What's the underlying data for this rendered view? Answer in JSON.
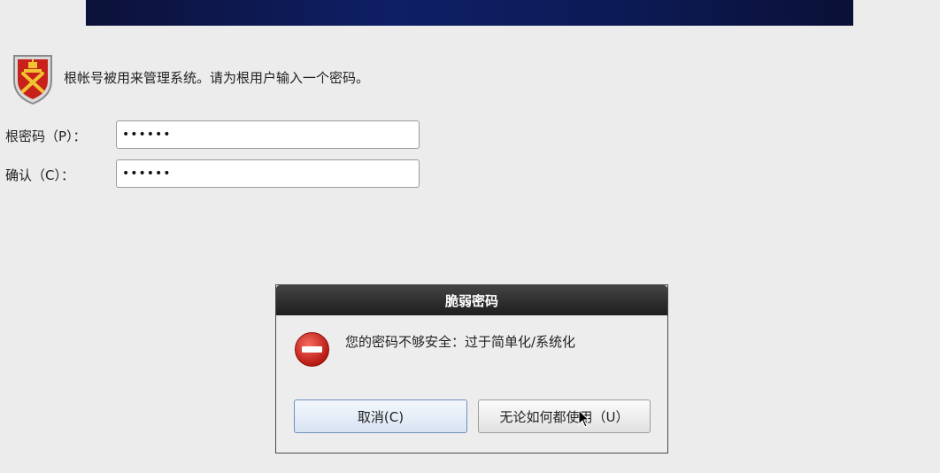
{
  "header": {
    "intro": "根帐号被用来管理系统。请为根用户输入一个密码。"
  },
  "form": {
    "password_label": "根密码（P）：",
    "password_value": "••••••",
    "confirm_label": "确认（C）：",
    "confirm_value": "••••••"
  },
  "dialog": {
    "title": "脆弱密码",
    "message": "您的密码不够安全：过于简单化/系统化",
    "cancel_label": "取消(C)",
    "use_anyway_label": "无论如何都使用（U）"
  },
  "colors": {
    "banner": "#0f1f66",
    "dialog_title_bg": "#2a2a2a",
    "error_icon": "#d8281e",
    "shield": "#c8201a"
  },
  "icons": [
    "shield-icon",
    "error-icon",
    "cursor-icon"
  ]
}
